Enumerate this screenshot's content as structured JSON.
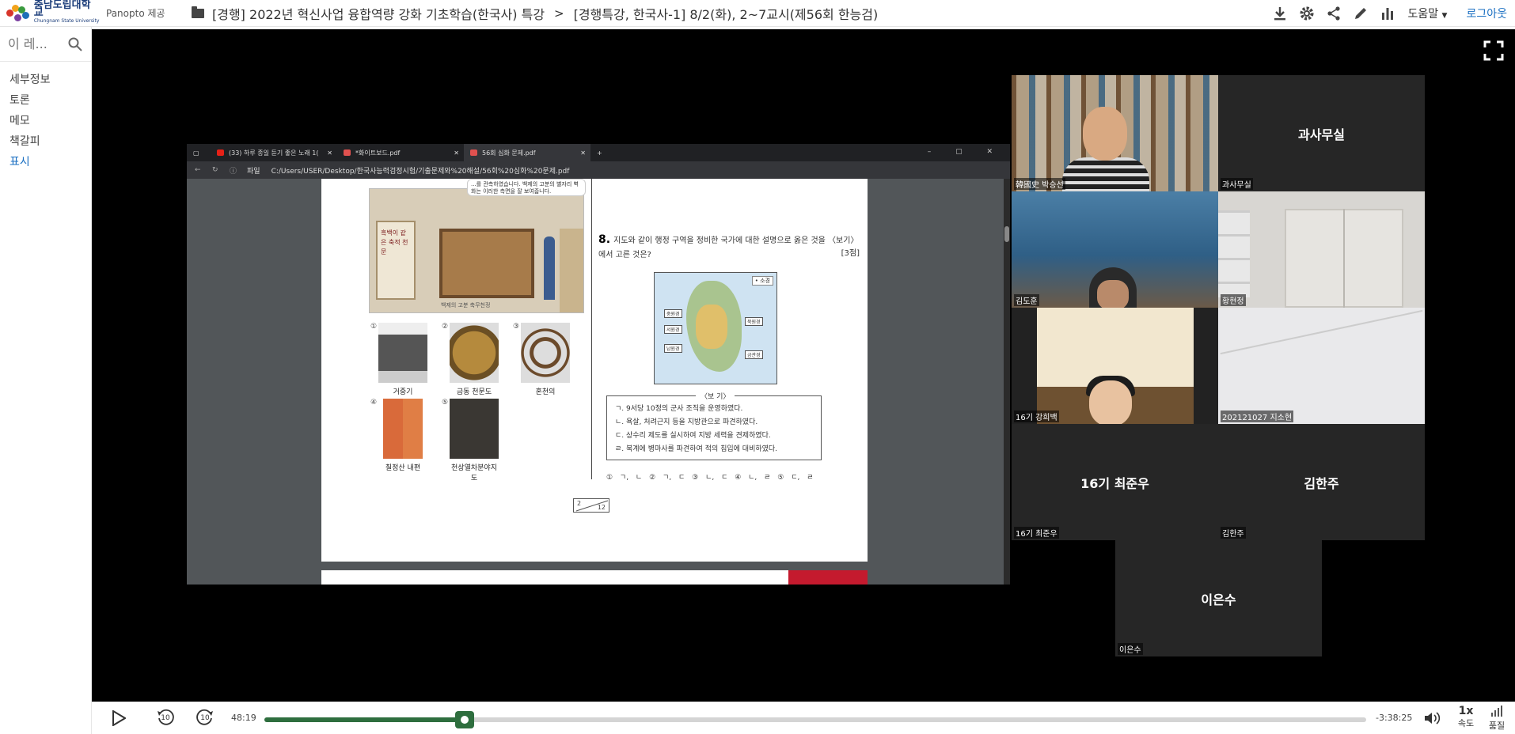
{
  "header": {
    "logo_ko": "충남도립대학교",
    "logo_en": "Chungnam State University",
    "provider": "Panopto 제공",
    "breadcrumb_folder": "[경행] 2022년 혁신사업 융합역량 강화 기초학습(한국사) 특강",
    "breadcrumb_session": "[경행특강, 한국사-1] 8/2(화), 2~7교시(제56회 한능검)",
    "help_label": "도움말",
    "login_label": "로그아웃"
  },
  "sidebar": {
    "search_placeholder": "이 레...",
    "items": [
      {
        "label": "세부정보"
      },
      {
        "label": "토론"
      },
      {
        "label": "메모"
      },
      {
        "label": "책갈피"
      },
      {
        "label": "표시"
      }
    ]
  },
  "browser": {
    "tabs": [
      {
        "label": "(33) 하루 종일 듣기 좋은 노래 1(",
        "color": "#e62117"
      },
      {
        "label": "*화이트보드.pdf",
        "color": "#e0514f"
      },
      {
        "label": "56회 심화 문제.pdf",
        "color": "#e0514f"
      }
    ],
    "address_label": "파일",
    "address": "C:/Users/USER/Desktop/한국사능력검정시험/기출문제와%20해설/56회%20심화%20문제.pdf"
  },
  "pdf": {
    "bubble": "...를 관측하였습니다. 백제의 고분의 별자리 벽화는 이러한 측면을 잘 보여줍니다.",
    "panel_text": "흑백이 같은 축적 천문",
    "illus_caption": "백제의 고분 축무천정",
    "options": [
      {
        "num": "①",
        "caption": "거중기"
      },
      {
        "num": "②",
        "caption": "금동 천문도"
      },
      {
        "num": "③",
        "caption": "혼천의"
      },
      {
        "num": "④",
        "caption": "칠정산 내편"
      },
      {
        "num": "⑤",
        "caption": "천상열차분야지도"
      }
    ],
    "question_num": "8.",
    "question": "지도와 같이 행정 구역을 정비한 국가에 대한 설명으로 옳은 것을 〈보기〉에서 고른 것은?",
    "points": "[3점]",
    "map_legend": "• 소경",
    "map_labels": [
      "중원경",
      "서원경",
      "남원경",
      "북원경",
      "금관경"
    ],
    "bogi_title": "〈보 기〉",
    "bogi": [
      "ㄱ. 9서당 10정의 군사 조직을 운영하였다.",
      "ㄴ. 욕살, 처려근지 등을 지방관으로 파견하였다.",
      "ㄷ. 상수리 제도를 실시하여 지방 세력을 견제하였다.",
      "ㄹ. 북계에 병마사를 파견하여 적의 침입에 대비하였다."
    ],
    "answers": "① ㄱ, ㄴ   ② ㄱ, ㄷ   ③ ㄴ, ㄷ   ④ ㄴ, ㄹ   ⑤ ㄷ, ㄹ",
    "page_a": "2",
    "page_b": "12"
  },
  "participants": [
    {
      "label": "韓國史 박승선",
      "name": ""
    },
    {
      "label": "과사무실",
      "name": "과사무실"
    },
    {
      "label": "김도훈",
      "name": ""
    },
    {
      "label": "황현정",
      "name": ""
    },
    {
      "label": "16기 강희백",
      "name": ""
    },
    {
      "label": "202121027 지소현",
      "name": ""
    },
    {
      "label": "16기 최준우",
      "name": "16기 최준우"
    },
    {
      "label": "김한주",
      "name": "김한주"
    },
    {
      "label": "이은수",
      "name": "이은수"
    }
  ],
  "controls": {
    "elapsed": "48:19",
    "remaining": "-3:38:25",
    "progress": 0.182,
    "speed_value": "1x",
    "speed_label": "속도",
    "quality_label": "품질",
    "skip_back": "10",
    "skip_fwd": "10"
  },
  "colors": {
    "accent": "#1a6fc2",
    "progress": "#2e6e3e"
  }
}
